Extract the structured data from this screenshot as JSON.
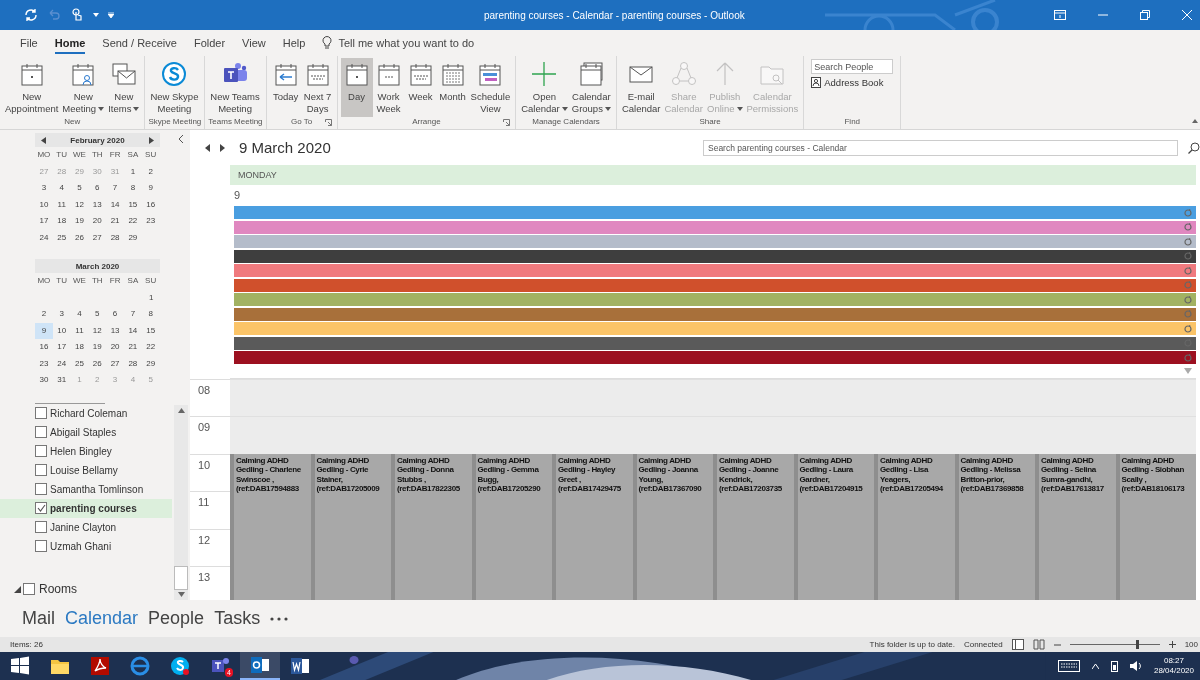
{
  "window": {
    "title": "parenting courses - Calendar - parenting courses  -  Outlook"
  },
  "menu": [
    {
      "label": "File",
      "selected": false
    },
    {
      "label": "Home",
      "selected": true
    },
    {
      "label": "Send / Receive",
      "selected": false
    },
    {
      "label": "Folder",
      "selected": false
    },
    {
      "label": "View",
      "selected": false
    },
    {
      "label": "Help",
      "selected": false
    }
  ],
  "tell_me": "Tell me what you want to do",
  "ribbon": [
    {
      "label": "New",
      "buttons": [
        {
          "lines": [
            "New",
            "Appointment"
          ],
          "disabled": false
        },
        {
          "lines": [
            "New",
            "Meeting"
          ],
          "dropdown": true,
          "disabled": false
        },
        {
          "lines": [
            "New",
            "Items"
          ],
          "dropdown": true,
          "disabled": false
        }
      ]
    },
    {
      "label": "Skype Meeting",
      "buttons": [
        {
          "lines": [
            "New Skype",
            "Meeting"
          ],
          "disabled": false
        }
      ]
    },
    {
      "label": "Teams Meeting",
      "buttons": [
        {
          "lines": [
            "New Teams",
            "Meeting"
          ],
          "disabled": false
        }
      ]
    },
    {
      "label": "Go To",
      "launcher": true,
      "buttons": [
        {
          "lines": [
            "Today"
          ],
          "disabled": false
        },
        {
          "lines": [
            "Next 7",
            "Days"
          ],
          "disabled": false
        }
      ]
    },
    {
      "label": "Arrange",
      "launcher": true,
      "buttons": [
        {
          "lines": [
            "Day"
          ],
          "disabled": false,
          "selected": true
        },
        {
          "lines": [
            "Work",
            "Week"
          ],
          "disabled": false,
          "selected": false
        },
        {
          "lines": [
            "Week"
          ],
          "disabled": false,
          "selected": false
        },
        {
          "lines": [
            "Month"
          ],
          "disabled": false,
          "selected": false
        },
        {
          "lines": [
            "Schedule",
            "View"
          ],
          "disabled": false,
          "selected": false
        }
      ]
    },
    {
      "label": "Manage Calendars",
      "buttons": [
        {
          "lines": [
            "Open",
            "Calendar"
          ],
          "dropdown": true,
          "disabled": false
        },
        {
          "lines": [
            "Calendar",
            "Groups"
          ],
          "dropdown": true,
          "disabled": false
        }
      ]
    },
    {
      "label": "Share",
      "buttons": [
        {
          "lines": [
            "E-mail",
            "Calendar"
          ],
          "disabled": false
        },
        {
          "lines": [
            "Share",
            "Calendar"
          ],
          "disabled": true
        },
        {
          "lines": [
            "Publish",
            "Online"
          ],
          "dropdown": true,
          "disabled": true
        },
        {
          "lines": [
            "Calendar",
            "Permissions"
          ],
          "disabled": true
        }
      ]
    }
  ],
  "find": {
    "label": "Find",
    "search": {
      "placeholder": "Search People"
    },
    "address_book": "Address Book"
  },
  "mini_calendars": [
    {
      "title": "February 2020",
      "arrows": true,
      "weekdays": [
        "MO",
        "TU",
        "WE",
        "TH",
        "FR",
        "SA",
        "SU"
      ],
      "weeks": [
        [
          {
            "d": "27",
            "other": true,
            "selected": false
          },
          {
            "d": "28",
            "other": true,
            "selected": false
          },
          {
            "d": "29",
            "other": true,
            "selected": false
          },
          {
            "d": "30",
            "other": true,
            "selected": false
          },
          {
            "d": "31",
            "other": true,
            "selected": false
          },
          {
            "d": "1",
            "other": false,
            "selected": false
          },
          {
            "d": "2",
            "other": false,
            "selected": false
          }
        ],
        [
          {
            "d": "3",
            "other": false,
            "selected": false
          },
          {
            "d": "4",
            "other": false,
            "selected": false
          },
          {
            "d": "5",
            "other": false,
            "selected": false
          },
          {
            "d": "6",
            "other": false,
            "selected": false
          },
          {
            "d": "7",
            "other": false,
            "selected": false
          },
          {
            "d": "8",
            "other": false,
            "selected": false
          },
          {
            "d": "9",
            "other": false,
            "selected": false
          }
        ],
        [
          {
            "d": "10",
            "other": false,
            "selected": false
          },
          {
            "d": "11",
            "other": false,
            "selected": false
          },
          {
            "d": "12",
            "other": false,
            "selected": false
          },
          {
            "d": "13",
            "other": false,
            "selected": false
          },
          {
            "d": "14",
            "other": false,
            "selected": false
          },
          {
            "d": "15",
            "other": false,
            "selected": false
          },
          {
            "d": "16",
            "other": false,
            "selected": false
          }
        ],
        [
          {
            "d": "17",
            "other": false,
            "selected": false
          },
          {
            "d": "18",
            "other": false,
            "selected": false
          },
          {
            "d": "19",
            "other": false,
            "selected": false
          },
          {
            "d": "20",
            "other": false,
            "selected": false
          },
          {
            "d": "21",
            "other": false,
            "selected": false
          },
          {
            "d": "22",
            "other": false,
            "selected": false
          },
          {
            "d": "23",
            "other": false,
            "selected": false
          }
        ],
        [
          {
            "d": "24",
            "other": false,
            "selected": false
          },
          {
            "d": "25",
            "other": false,
            "selected": false
          },
          {
            "d": "26",
            "other": false,
            "selected": false
          },
          {
            "d": "27",
            "other": false,
            "selected": false
          },
          {
            "d": "28",
            "other": false,
            "selected": false
          },
          {
            "d": "29",
            "other": false,
            "selected": false
          }
        ]
      ]
    },
    {
      "title": "March 2020",
      "arrows": false,
      "weekdays": [
        "MO",
        "TU",
        "WE",
        "TH",
        "FR",
        "SA",
        "SU"
      ],
      "weeks": [
        [
          {
            "d": "1",
            "other": false,
            "selected": false
          }
        ],
        [
          {
            "d": "2",
            "other": false,
            "selected": false
          },
          {
            "d": "3",
            "other": false,
            "selected": false
          },
          {
            "d": "4",
            "other": false,
            "selected": false
          },
          {
            "d": "5",
            "other": false,
            "selected": false
          },
          {
            "d": "6",
            "other": false,
            "selected": false
          },
          {
            "d": "7",
            "other": false,
            "selected": false
          },
          {
            "d": "8",
            "other": false,
            "selected": false
          }
        ],
        [
          {
            "d": "9",
            "other": false,
            "selected": true
          },
          {
            "d": "10",
            "other": false,
            "selected": false
          },
          {
            "d": "11",
            "other": false,
            "selected": false
          },
          {
            "d": "12",
            "other": false,
            "selected": false
          },
          {
            "d": "13",
            "other": false,
            "selected": false
          },
          {
            "d": "14",
            "other": false,
            "selected": false
          },
          {
            "d": "15",
            "other": false,
            "selected": false
          }
        ],
        [
          {
            "d": "16",
            "other": false,
            "selected": false
          },
          {
            "d": "17",
            "other": false,
            "selected": false
          },
          {
            "d": "18",
            "other": false,
            "selected": false
          },
          {
            "d": "19",
            "other": false,
            "selected": false
          },
          {
            "d": "20",
            "other": false,
            "selected": false
          },
          {
            "d": "21",
            "other": false,
            "selected": false
          },
          {
            "d": "22",
            "other": false,
            "selected": false
          }
        ],
        [
          {
            "d": "23",
            "other": false,
            "selected": false
          },
          {
            "d": "24",
            "other": false,
            "selected": false
          },
          {
            "d": "25",
            "other": false,
            "selected": false
          },
          {
            "d": "26",
            "other": false,
            "selected": false
          },
          {
            "d": "27",
            "other": false,
            "selected": false
          },
          {
            "d": "28",
            "other": false,
            "selected": false
          },
          {
            "d": "29",
            "other": false,
            "selected": false
          }
        ],
        [
          {
            "d": "30",
            "other": false,
            "selected": false
          },
          {
            "d": "31",
            "other": false,
            "selected": false
          },
          {
            "d": "1",
            "other": true,
            "selected": false
          },
          {
            "d": "2",
            "other": true,
            "selected": false
          },
          {
            "d": "3",
            "other": true,
            "selected": false
          },
          {
            "d": "4",
            "other": true,
            "selected": false
          },
          {
            "d": "5",
            "other": true,
            "selected": false
          }
        ]
      ]
    }
  ],
  "calendars": [
    {
      "label": "Richard Coleman",
      "checked": false,
      "selected": false
    },
    {
      "label": "Abigail Staples",
      "checked": false,
      "selected": false
    },
    {
      "label": "Helen Bingley",
      "checked": false,
      "selected": false
    },
    {
      "label": "Louise Bellamy",
      "checked": false,
      "selected": false
    },
    {
      "label": "Samantha Tomlinson",
      "checked": false,
      "selected": false
    },
    {
      "label": "parenting courses",
      "checked": true,
      "selected": true
    },
    {
      "label": "Janine Clayton",
      "checked": false,
      "selected": false
    },
    {
      "label": "Uzmah Ghani",
      "checked": false,
      "selected": false
    }
  ],
  "rooms": {
    "label": "Rooms",
    "checked": false,
    "expanded": true
  },
  "calendar": {
    "date": "9 March 2020",
    "search": {
      "placeholder": "Search parenting courses - Calendar"
    },
    "weekday": "MONDAY",
    "day": "9",
    "all_day": [
      {
        "color": "#4a9ee0"
      },
      {
        "color": "#e088c0"
      },
      {
        "color": "#b4bcca"
      },
      {
        "color": "#3e3e3e"
      },
      {
        "color": "#f07a7e"
      },
      {
        "color": "#d0502c"
      },
      {
        "color": "#a2b262"
      },
      {
        "color": "#a8703a"
      },
      {
        "color": "#fbc468"
      },
      {
        "color": "#5a5a5a"
      },
      {
        "color": "#9c1020"
      }
    ],
    "hours": [
      "08",
      "09",
      "10",
      "11",
      "12",
      "13"
    ],
    "events": [
      "Calming ADHD Gedling - Charlene Swinscoe , (ref:DAB17594883",
      "Calming ADHD Gedling - Cyrie Stainer, (ref:DAB17205009",
      "Calming ADHD Gedling - Donna Stubbs , (ref:DAB17822305",
      "Calming ADHD Gedling - Gemma Bugg, (ref:DAB17205290",
      "Calming ADHD Gedling - Hayley Greet , (ref:DAB17429475",
      "Calming ADHD Gedling - Joanna Young, (ref:DAB17367090",
      "Calming ADHD Gedling - Joanne Kendrick, (ref:DAB17203735",
      "Calming ADHD Gedling - Laura Gardner, (ref:DAB17204915",
      "Calming ADHD Gedling - Lisa Yeagers, (ref:DAB17205494",
      "Calming ADHD Gedling - Melissa Britton-prior, (ref:DAB17369858",
      "Calming ADHD Gedling - Selina Sumra-gandhi, (ref:DAB17613817",
      "Calming ADHD Gedling - Siobhan Scally , (ref:DAB18106173"
    ]
  },
  "nav": [
    {
      "label": "Mail",
      "selected": false
    },
    {
      "label": "Calendar",
      "selected": true
    },
    {
      "label": "People",
      "selected": false
    },
    {
      "label": "Tasks",
      "selected": false
    }
  ],
  "status_bar": {
    "items": "Items: 26",
    "sync": "This folder is up to date.",
    "connection": "Connected",
    "zoom": {
      "level": 0.74,
      "reading": "100"
    }
  },
  "taskbar": {
    "apps": [
      {
        "active": false
      },
      {
        "active": false
      },
      {
        "active": false
      },
      {
        "active": false
      },
      {
        "active": false
      },
      {
        "active": false,
        "badge": "4"
      },
      {
        "active": true
      },
      {
        "active": false
      }
    ],
    "time": "08:27",
    "date": "28/04/2020"
  }
}
